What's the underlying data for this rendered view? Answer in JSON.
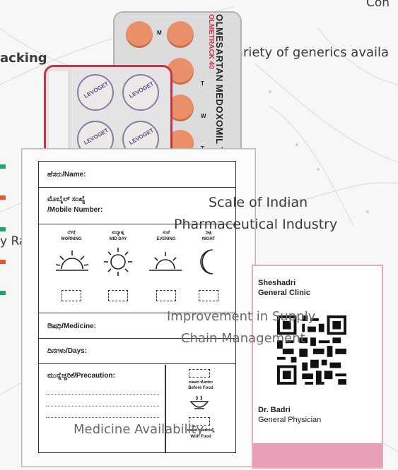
{
  "background_text": {
    "top_right": "Con",
    "left_top": "acking",
    "variety": "Variety of generics availa",
    "rates": "y Rates",
    "scale_line1": "Scale of Indian",
    "scale_line2": "Pharmaceutical Industry",
    "improvement_line1": "Improvement in Supply",
    "improvement_line2": "Chain Management",
    "availability": "Medicine Availability"
  },
  "blister_front": {
    "brand": "LEVOGET"
  },
  "blister_back": {
    "title": "OLMESARTAN MEDOXOMIL TABLE",
    "brand": "OLMETRACK 40",
    "day_labels": [
      "M",
      "T",
      "W",
      "T"
    ]
  },
  "form": {
    "name_label": "ಹೆಸರು/Name:",
    "mobile_label_kn": "ಮೊಬೈಲ್ ಸಂಖ್ಯೆ",
    "mobile_label_en": "/Mobile Number:",
    "times": [
      {
        "kn": "ಬೆಳಗ್ಗೆ",
        "en": "MORNING"
      },
      {
        "kn": "ಮಧ್ಯಾಹ್ನ",
        "en": "MID DAY"
      },
      {
        "kn": "ಸಂಜೆ",
        "en": "EVENING"
      },
      {
        "kn": "ರಾತ್ರಿ",
        "en": "NIGHT"
      }
    ],
    "medicine_label": "ಔಷಧಿ/Medicine:",
    "days_label": "ದಿನಗಳು/Days:",
    "precaution_label": "ಮುನ್ನೆಚ್ಚರಿಕೆ/Precaution:",
    "before_food_kn": "ಊಟದ ಮೊದಲು",
    "before_food_en": "Before Food",
    "with_food_kn": "ಊಟದ ಜೊತೆಯಲ್ಲಿ",
    "with_food_en": "With Food"
  },
  "card": {
    "clinic_line1": "Sheshadri",
    "clinic_line2": "General Clinic",
    "doctor": "Dr. Badri",
    "role": "General Physician"
  },
  "colors": {
    "accent_green": "#1aa86b",
    "accent_red": "#e8543a",
    "pill_orange": "#e9906a",
    "card_pink": "#e99fb5",
    "blister_red": "#c8334a"
  }
}
